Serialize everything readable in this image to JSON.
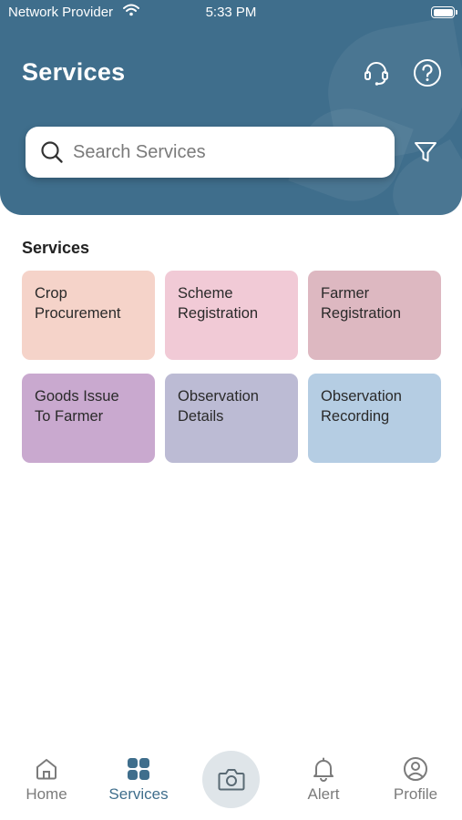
{
  "status_bar": {
    "carrier": "Network Provider",
    "time": "5:33 PM"
  },
  "header": {
    "title": "Services",
    "support_icon": "headset-icon",
    "help_icon": "question-circle-icon"
  },
  "search": {
    "placeholder": "Search Services",
    "value": "",
    "filter_icon": "filter-icon"
  },
  "section": {
    "title": "Services"
  },
  "tiles": [
    {
      "line1": "Crop",
      "line2": "Procurement",
      "color": "#f5d3c9"
    },
    {
      "line1": "Scheme",
      "line2": "Registration",
      "color": "#f1cad6"
    },
    {
      "line1": "Farmer",
      "line2": "Registration",
      "color": "#ddb8c1"
    },
    {
      "line1": "Goods Issue",
      "line2": "To Farmer",
      "color": "#c9a9cf"
    },
    {
      "line1": "Observation",
      "line2": "Details",
      "color": "#bcbbd4"
    },
    {
      "line1": "Observation",
      "line2": "Recording",
      "color": "#b5cde3"
    }
  ],
  "nav": {
    "items": [
      {
        "label": "Home",
        "icon": "home-icon"
      },
      {
        "label": "Services",
        "icon": "grid-icon"
      },
      {
        "label": "Alert",
        "icon": "bell-icon"
      },
      {
        "label": "Profile",
        "icon": "user-circle-icon"
      }
    ],
    "camera_icon": "camera-icon",
    "active_index": 1
  },
  "colors": {
    "brand": "#3f6e8c",
    "nav_inactive": "#7b7b7b"
  }
}
